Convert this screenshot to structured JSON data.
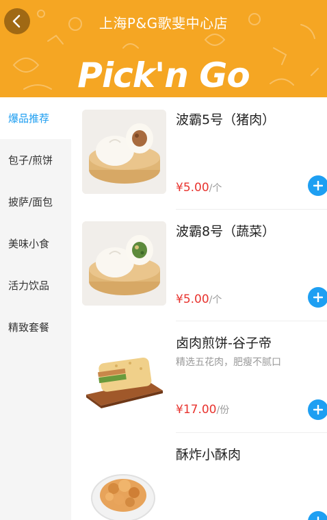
{
  "header": {
    "store_name": "上海P&G歌斐中心店",
    "brand": "Pick'n Go",
    "back_icon": "chevron-left-icon",
    "background_color": "#f5a623"
  },
  "sidebar": {
    "active_index": 0,
    "items": [
      {
        "label": "爆品推荐"
      },
      {
        "label": "包子/煎饼"
      },
      {
        "label": "披萨/面包"
      },
      {
        "label": "美味小食"
      },
      {
        "label": "活力饮品"
      },
      {
        "label": "精致套餐"
      }
    ]
  },
  "products": [
    {
      "name": "波霸5号（猪肉）",
      "desc": "",
      "price": "¥5.00",
      "unit": "个",
      "image": "pork-bun-steamer",
      "add_icon": "plus-icon"
    },
    {
      "name": "波霸8号（蔬菜）",
      "desc": "",
      "price": "¥5.00",
      "unit": "个",
      "image": "vegetable-bun-steamer",
      "add_icon": "plus-icon"
    },
    {
      "name": "卤肉煎饼-谷子帝",
      "desc": "精选五花肉，肥瘦不腻口",
      "price": "¥17.00",
      "unit": "份",
      "image": "braised-pork-pancake",
      "add_icon": "plus-icon"
    },
    {
      "name": "酥炸小酥肉",
      "desc": "",
      "price": "",
      "unit": "",
      "image": "crispy-fried-pork",
      "add_icon": "plus-icon"
    }
  ],
  "colors": {
    "accent": "#1e9ff2",
    "active_category": "#1a9cf0",
    "price": "#e8332e"
  }
}
